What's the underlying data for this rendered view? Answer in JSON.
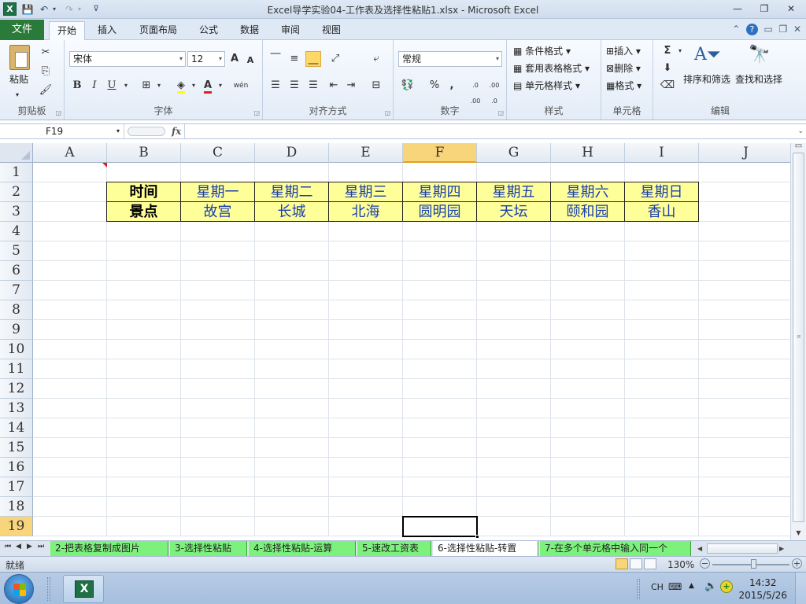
{
  "window": {
    "title": "Excel导学实验04-工作表及选择性粘贴1.xlsx - Microsoft Excel",
    "app_icon": "X",
    "min": "—",
    "max": "❐",
    "close": "✕"
  },
  "qat": {
    "save": "💾",
    "undo": "↶",
    "redo": "↷",
    "customize": "⊽"
  },
  "ribbon_tabs": {
    "file": "文件",
    "items": [
      "开始",
      "插入",
      "页面布局",
      "公式",
      "数据",
      "审阅",
      "视图"
    ],
    "active": "开始"
  },
  "clipboard": {
    "paste": "粘贴",
    "label": "剪贴板"
  },
  "font": {
    "name": "宋体",
    "size": "12",
    "label": "字体",
    "bold": "B",
    "italic": "I",
    "underline": "U",
    "grow": "A",
    "shrink": "A",
    "color_letter": "A",
    "wen": "wén"
  },
  "alignment": {
    "label": "对齐方式"
  },
  "number": {
    "format": "常规",
    "label": "数字",
    "percent": "%",
    "comma": ",",
    "inc_dec": ".0 .00",
    "dec_dec": ".00 .0"
  },
  "styles": {
    "conditional": "条件格式",
    "table": "套用表格格式",
    "cell": "单元格样式",
    "label": "样式"
  },
  "cells": {
    "insert": "插入",
    "delete": "删除",
    "format": "格式",
    "label": "单元格"
  },
  "editing": {
    "sigma": "Σ",
    "sort": "排序和筛选",
    "find": "查找和选择",
    "label": "编辑"
  },
  "formula_bar": {
    "name_box": "F19",
    "fx": "fx",
    "formula": ""
  },
  "columns": [
    "A",
    "B",
    "C",
    "D",
    "E",
    "F",
    "G",
    "H",
    "I",
    "J"
  ],
  "selected_column": "F",
  "rows": [
    "1",
    "2",
    "3",
    "4",
    "5",
    "6",
    "7",
    "8",
    "9",
    "10",
    "11",
    "12",
    "13",
    "14",
    "15",
    "16",
    "17",
    "18",
    "19"
  ],
  "selected_row": "19",
  "table": {
    "row2": [
      "时间",
      "星期一",
      "星期二",
      "星期三",
      "星期四",
      "星期五",
      "星期六",
      "星期日"
    ],
    "row3": [
      "景点",
      "故宫",
      "长城",
      "北海",
      "圆明园",
      "天坛",
      "颐和园",
      "香山"
    ],
    "fill": "#ffff99",
    "value_color": "#1a3fae"
  },
  "sheet_tabs": [
    "2-把表格复制成图片",
    "3-选择性粘贴",
    "4-选择性粘贴-运算",
    "5-速改工资表",
    "6-选择性粘贴-转置",
    "7-在多个单元格中输入同一个"
  ],
  "active_sheet": "6-选择性粘贴-转置",
  "tab_color": "#7cf27c",
  "status": {
    "ready": "就绪",
    "zoom": "130%",
    "zoom_out": "−",
    "zoom_in": "+"
  },
  "taskbar": {
    "ime": "CH",
    "time": "14:32",
    "date": "2015/5/26"
  }
}
